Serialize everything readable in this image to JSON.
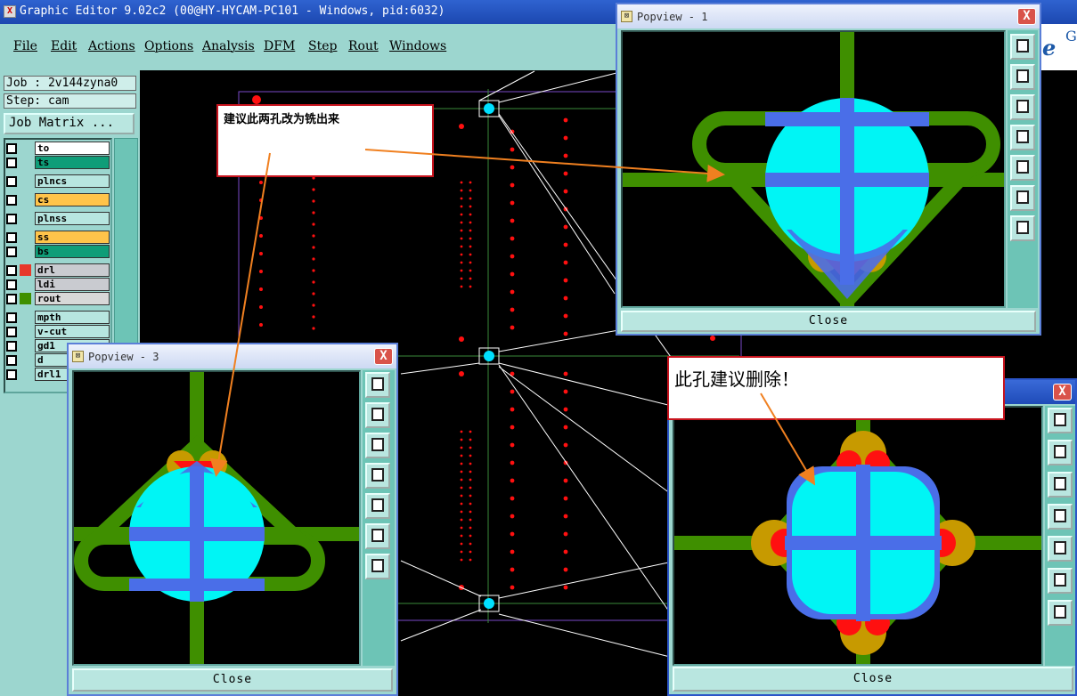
{
  "window": {
    "title": "Graphic Editor 9.02c2 (00@HY-HYCAM-PC101 - Windows, pid:6032)"
  },
  "menu": {
    "items": [
      "File",
      "Edit",
      "Actions",
      "Options",
      "Analysis",
      "DFM",
      "Step",
      "Rout",
      "Windows"
    ]
  },
  "logo": {
    "text": "e",
    "super": "G"
  },
  "job": {
    "job_label": "Job : 2v144zyna0",
    "step_label": "Step: cam",
    "matrix_button": "Job Matrix ..."
  },
  "layers": [
    {
      "name": "to",
      "color": "#ffffff"
    },
    {
      "name": "ts",
      "color": "#0f9d78"
    },
    {
      "name": "plncs",
      "color": "#b7e6e0"
    },
    {
      "name": "cs",
      "color": "#ffc44a"
    },
    {
      "name": "plnss",
      "color": "#b7e6e0"
    },
    {
      "name": "ss",
      "color": "#ffc44a"
    },
    {
      "name": "bs",
      "color": "#0f9d78"
    },
    {
      "name": "drl",
      "color": "#c9cbd0"
    },
    {
      "name": "ldi",
      "color": "#c9cbd0"
    },
    {
      "name": "rout",
      "color": "#d8d8d8"
    },
    {
      "name": "mpth",
      "color": "#b7e6e0"
    },
    {
      "name": "v-cut",
      "color": "#b7e6e0"
    },
    {
      "name": "gd1",
      "color": "#b7e6e0"
    },
    {
      "name": "d",
      "color": "#b7e6e0"
    },
    {
      "name": "drl1",
      "color": "#b7e6e0"
    }
  ],
  "popups": {
    "p1": {
      "title": "Popview - 1",
      "close": "Close",
      "close_x": "X"
    },
    "p3": {
      "title": "Popview - 3",
      "close": "Close",
      "close_x": "X"
    },
    "p2": {
      "close": "Close",
      "close_x": "X"
    }
  },
  "annotations": {
    "a1": "建议此两孔改为铣出来",
    "a2": "此孔建议删除！"
  },
  "colors": {
    "pad_green": "#3f8f00",
    "hole_cyan": "#00f5f5",
    "cross_blue": "#4a6ee8",
    "drill_red": "#ff1010",
    "ring_gold": "#c79a00",
    "arrow_orange": "#f08020"
  }
}
